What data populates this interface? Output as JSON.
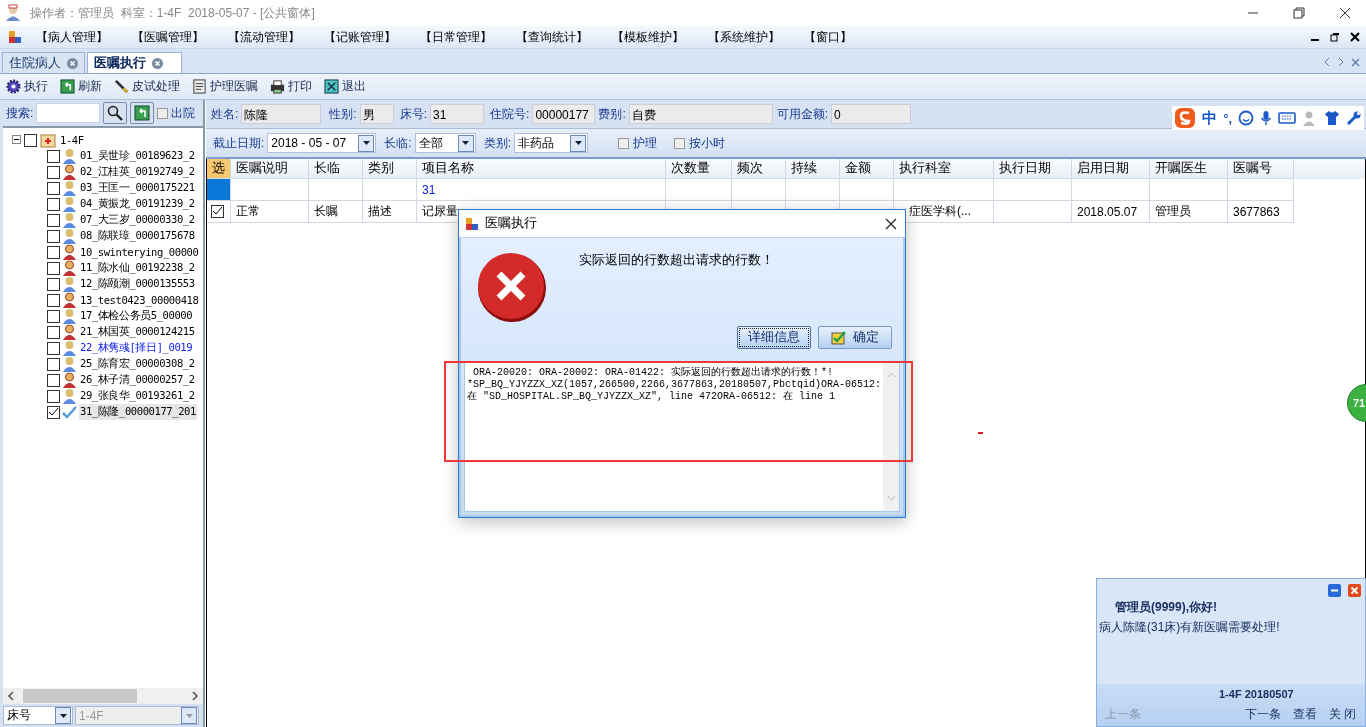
{
  "title_bar": {
    "text": "操作者：管理员  科室：1-4F  2018-05-07 - [公共窗体]"
  },
  "menu": [
    "【病人管理】",
    "【医嘱管理】",
    "【流动管理】",
    "【记账管理】",
    "【日常管理】",
    "【查询统计】",
    "【模板维护】",
    "【系统维护】",
    "【窗口】"
  ],
  "tabs": [
    {
      "label": "住院病人",
      "selected": false
    },
    {
      "label": "医嘱执行",
      "selected": true
    }
  ],
  "toolbar": [
    {
      "label": "执行",
      "kind": "gear"
    },
    {
      "label": "刷新",
      "kind": "refresh"
    },
    {
      "label": "皮试处理",
      "kind": "pen"
    },
    {
      "label": "护理医嘱",
      "kind": "document"
    },
    {
      "label": "打印",
      "kind": "printer"
    },
    {
      "label": "退出",
      "kind": "exit"
    }
  ],
  "search": {
    "label": "搜索:"
  },
  "discharged": {
    "label": "出院",
    "checked": false
  },
  "tree": {
    "label": "1-4F",
    "expanded": true,
    "checked": false,
    "children": [
      {
        "label": "01_吴世珍_00189623_2",
        "kind": "male",
        "checked": false,
        "selected": false,
        "flagged": false
      },
      {
        "label": "02_江桂英_00192749_2",
        "kind": "female",
        "checked": false,
        "selected": false,
        "flagged": false
      },
      {
        "label": "03_王匡一_0000175221",
        "kind": "male",
        "checked": false,
        "selected": false,
        "flagged": false
      },
      {
        "label": "04_黄振龙_00191239_2",
        "kind": "male",
        "checked": false,
        "selected": false,
        "flagged": false
      },
      {
        "label": "07_大三岁_00000330_2",
        "kind": "male",
        "checked": false,
        "selected": false,
        "flagged": false
      },
      {
        "label": "08_陈联璋_0000175678",
        "kind": "male",
        "checked": false,
        "selected": false,
        "flagged": false
      },
      {
        "label": "10_swinterying_00000",
        "kind": "female",
        "checked": false,
        "selected": false,
        "flagged": false
      },
      {
        "label": "11_陈水仙_00192238_2",
        "kind": "female",
        "checked": false,
        "selected": false,
        "flagged": false
      },
      {
        "label": "12_陈颐潮_0000135553",
        "kind": "male",
        "checked": false,
        "selected": false,
        "flagged": false
      },
      {
        "label": "13_test0423_00000418",
        "kind": "female",
        "checked": false,
        "selected": false,
        "flagged": false
      },
      {
        "label": "17_体检公务员5_00000",
        "kind": "male",
        "checked": false,
        "selected": false,
        "flagged": false
      },
      {
        "label": "21_林国英_0000124215",
        "kind": "female",
        "checked": false,
        "selected": false,
        "flagged": false
      },
      {
        "label": "22_林隽彧[择日]_0019",
        "kind": "male",
        "checked": false,
        "selected": false,
        "flagged": true
      },
      {
        "label": "25_陈育宏_00000308_2",
        "kind": "male",
        "checked": false,
        "selected": false,
        "flagged": false
      },
      {
        "label": "26_林子清_00000257_2",
        "kind": "female",
        "checked": false,
        "selected": false,
        "flagged": false
      },
      {
        "label": "29_张良华_00193261_2",
        "kind": "male",
        "checked": false,
        "selected": false,
        "flagged": false
      },
      {
        "label": "31_陈隆_00000177_201",
        "kind": "done",
        "checked": true,
        "selected": true,
        "flagged": false
      }
    ]
  },
  "bed_selector": {
    "value": "床号"
  },
  "ward_selector": {
    "value": "1-4F",
    "disabled": true
  },
  "patient_info": [
    {
      "label": "姓名:",
      "value": "陈隆"
    },
    {
      "label": "性别:",
      "value": "男"
    },
    {
      "label": "床号:",
      "value": "31"
    },
    {
      "label": "住院号:",
      "value": "00000177"
    },
    {
      "label": "费别:",
      "value": "自费"
    },
    {
      "label": "可用金额:",
      "value": "0"
    }
  ],
  "filters": {
    "date": {
      "label": "截止日期:",
      "value": "2018 - 05 - 07"
    },
    "long_term": {
      "label": "长临:",
      "value": "全部"
    },
    "category": {
      "label": "类别:",
      "value": "非药品"
    },
    "checkboxes": [
      {
        "label": "护理",
        "checked": false
      },
      {
        "label": "按小时",
        "checked": false
      }
    ]
  },
  "ime_toolbar": {
    "mode": "中",
    "punctuation": "°,"
  },
  "table": {
    "columns": [
      {
        "label": "选",
        "selected": true
      },
      {
        "label": "医嘱说明",
        "selected": false
      },
      {
        "label": "长临",
        "selected": false
      },
      {
        "label": "类别",
        "selected": false
      },
      {
        "label": "项目名称",
        "selected": false
      },
      {
        "label": "次数量",
        "selected": false
      },
      {
        "label": "频次",
        "selected": false
      },
      {
        "label": "持续",
        "selected": false
      },
      {
        "label": "金额",
        "selected": false
      },
      {
        "label": "执行科室",
        "selected": false
      },
      {
        "label": "执行日期",
        "selected": false
      },
      {
        "label": "启用日期",
        "selected": false
      },
      {
        "label": "开嘱医生",
        "selected": false
      },
      {
        "label": "医嘱号",
        "selected": false
      }
    ],
    "rows": [
      {
        "selected": true,
        "cells": [
          "",
          "",
          "",
          "",
          "31",
          "",
          "",
          "",
          "",
          "",
          "",
          "",
          "",
          ""
        ]
      },
      {
        "selected": false,
        "checked": true,
        "cells": [
          "",
          "正常",
          "长嘱",
          "描述",
          "记尿量",
          "",
          "",
          "",
          "",
          "症医学科(...",
          "",
          "2018.05.07",
          "管理员",
          "3677863"
        ]
      }
    ]
  },
  "dialog": {
    "title": "医嘱执行",
    "message": "实际返回的行数超出请求的行数！",
    "buttons": [
      {
        "label": "详细信息",
        "kind": "details"
      },
      {
        "label": "确定",
        "kind": "ok"
      }
    ],
    "detail_lines": [
      "ORA-20020: ORA-20002: ORA-01422: 实际返回的行数超出请求的行数！*!",
      "*SP_BQ_YJYZZX_XZ(1057,266500,2266,3677863,20180507,Pbctqid)ORA-06512:",
      "在 \"SD_HOSPITAL.SP_BQ_YJYZZX_XZ\", line 472ORA-06512: 在 line 1"
    ]
  },
  "notification": {
    "greeting": "管理员(9999),你好!",
    "message": "病人陈隆(31床)有新医嘱需要处理!",
    "footer": "1-4F 20180507",
    "actions": [
      {
        "label": "上一条",
        "disabled": true
      },
      {
        "label": "下一条",
        "disabled": false
      },
      {
        "label": "查看",
        "disabled": false
      },
      {
        "label": "关 闭",
        "disabled": false
      }
    ]
  },
  "side_badge": {
    "text": "71"
  }
}
